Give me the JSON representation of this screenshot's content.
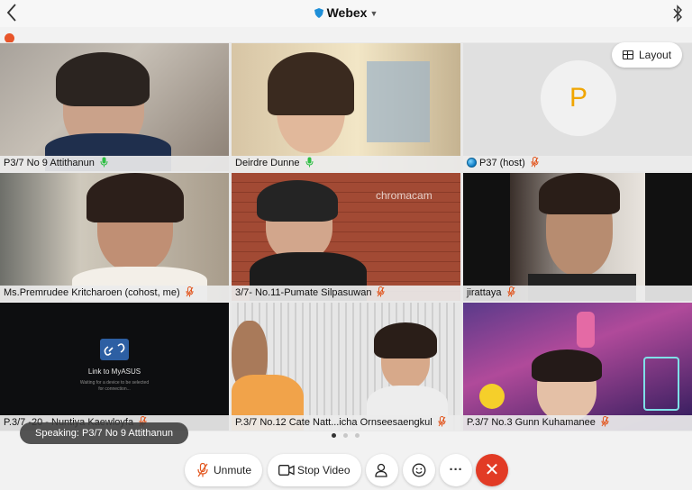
{
  "app": {
    "title": "Webex"
  },
  "layout_label": "Layout",
  "host_avatar_letter": "P",
  "participants": [
    {
      "name": "P3/7 No 9 Attithanun",
      "mic": "green"
    },
    {
      "name": "Deirdre Dunne",
      "mic": "green"
    },
    {
      "name": "P37 (host)",
      "mic": "muted"
    },
    {
      "name": "Ms.Premrudee Kritcharoen (cohost, me)",
      "mic": "muted"
    },
    {
      "name": "3/7- No.11-Pumate Silpasuwan",
      "mic": "muted"
    },
    {
      "name": "jirattaya",
      "mic": "muted"
    },
    {
      "name": "P.3/7 -20 - Nuntiya Kaewloyfa",
      "mic": "muted"
    },
    {
      "name": "P.3/7 No.12 Cate Natt...icha Ornseesaengkul",
      "mic": "muted"
    },
    {
      "name": "P.3/7 No.3 Gunn Kuhamanee",
      "mic": "muted"
    }
  ],
  "tile_text": {
    "chromacam": "chromacam",
    "myasus_title": "Link to MyASUS",
    "myasus_sub": "Waiting for a device to be selected for connection..."
  },
  "pager": {
    "pages": 3,
    "active": 1
  },
  "speaking": "Speaking: P3/7 No 9 Attithanun",
  "controls": {
    "unmute": "Unmute",
    "stop_video": "Stop Video",
    "more": "···",
    "end": "✕"
  },
  "colors": {
    "accent": "#2a9ad6",
    "mic_active": "#2fbf45",
    "mic_muted": "#e2561e",
    "end_call": "#e23b25",
    "avatar_letter": "#f0a500"
  }
}
